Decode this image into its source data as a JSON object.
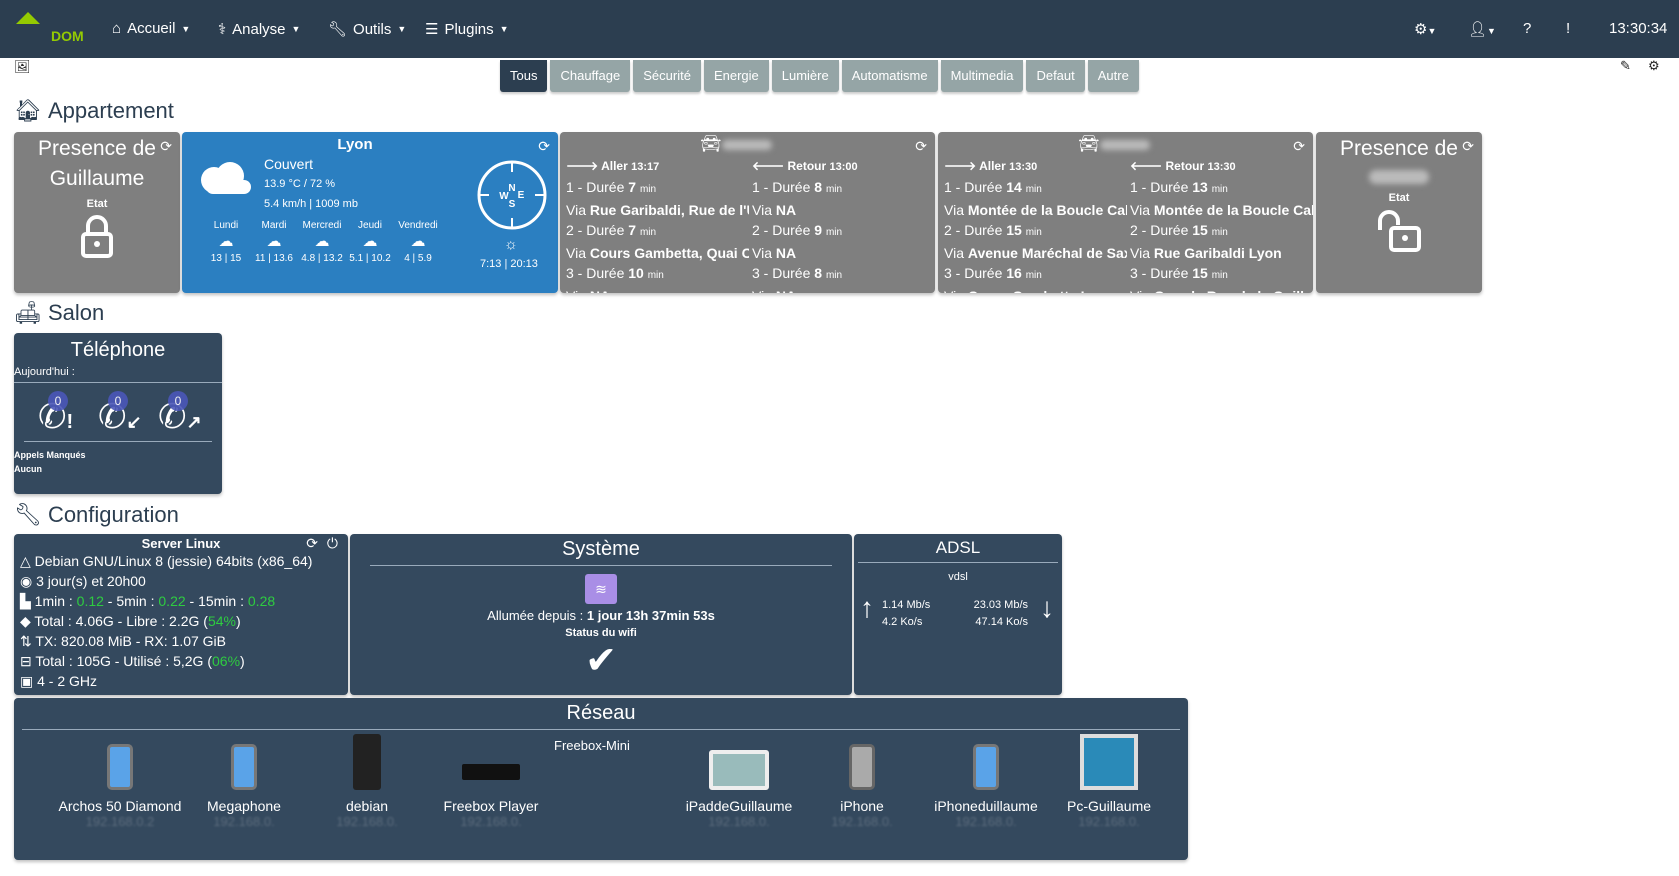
{
  "nav": {
    "logo_text": "DOM",
    "menus": [
      "Accueil",
      "Analyse",
      "Outils",
      "Plugins"
    ],
    "time": "13:30:34"
  },
  "tabs": [
    "Tous",
    "Chauffage",
    "Sécurité",
    "Energie",
    "Lumière",
    "Automatisme",
    "Multimedia",
    "Defaut",
    "Autre"
  ],
  "active_tab": "Tous",
  "sections": {
    "appartement": "Appartement",
    "salon": "Salon",
    "configuration": "Configuration"
  },
  "presence1": {
    "title": "Presence de Guillaume",
    "label": "Etat",
    "state": "locked"
  },
  "presence2": {
    "title": "Presence de",
    "label": "Etat",
    "state": "unlocked"
  },
  "weather": {
    "city": "Lyon",
    "condition": "Couvert",
    "temp_hum": "13.9 °C / 72 %",
    "wind_pressure": "5.4 km/h | 1009 mb",
    "sun": "7:13 | 20:13",
    "days": [
      {
        "name": "Lundi",
        "temps": "13 | 15"
      },
      {
        "name": "Mardi",
        "temps": "11 | 13.6"
      },
      {
        "name": "Mercredi",
        "temps": "4.8 | 13.2"
      },
      {
        "name": "Jeudi",
        "temps": "5.1 | 10.2"
      },
      {
        "name": "Vendredi",
        "temps": "4 | 5.9"
      }
    ]
  },
  "travel": [
    {
      "aller": {
        "label": "Aller",
        "time": "13:17",
        "routes": [
          {
            "n": "1 - Durée",
            "d": "7",
            "via": "Rue Garibaldi, Rue de l'U"
          },
          {
            "n": "2 - Durée",
            "d": "7",
            "via": "Cours Gambetta, Quai Cl"
          },
          {
            "n": "3 - Durée",
            "d": "10",
            "via": "NA"
          }
        ]
      },
      "retour": {
        "label": "Retour",
        "time": "13:00",
        "routes": [
          {
            "n": "1 - Durée",
            "d": "8",
            "via": "NA"
          },
          {
            "n": "2 - Durée",
            "d": "9",
            "via": "NA"
          },
          {
            "n": "3 - Durée",
            "d": "8",
            "via": "NA"
          }
        ]
      }
    },
    {
      "aller": {
        "label": "Aller",
        "time": "13:30",
        "routes": [
          {
            "n": "1 - Durée",
            "d": "14",
            "via": "Montée de la Boucle Calı"
          },
          {
            "n": "2 - Durée",
            "d": "15",
            "via": "Avenue Maréchal de Sax"
          },
          {
            "n": "3 - Durée",
            "d": "16",
            "via": "Cours Gambetta Lyon"
          }
        ]
      },
      "retour": {
        "label": "Retour",
        "time": "13:30",
        "routes": [
          {
            "n": "1 - Durée",
            "d": "13",
            "via": "Montée de la Boucle Cal"
          },
          {
            "n": "2 - Durée",
            "d": "15",
            "via": "Rue Garibaldi Lyon"
          },
          {
            "n": "3 - Durée",
            "d": "15",
            "via": "Grande Rue de la Guillot"
          }
        ]
      }
    }
  ],
  "travel_units": {
    "min": "min",
    "via": "Via"
  },
  "telephone": {
    "title": "Téléphone",
    "today": "Aujourd'hui :",
    "counts": [
      "0",
      "0",
      "0"
    ],
    "missed_label": "Appels Manqués",
    "missed_value": "Aucun"
  },
  "server": {
    "title": "Server Linux",
    "os": "Debian GNU/Linux 8 (jessie) 64bits (x86_64)",
    "uptime": "3 jour(s) et 20h00",
    "load": {
      "l1": "1min : ",
      "v1": "0.12",
      "l5": " - 5min : ",
      "v5": "0.22",
      "l15": " - 15min : ",
      "v15": "0.28"
    },
    "mem": {
      "text": "Total : 4.06G - Libre : 2.2G (",
      "pct": "54%",
      "end": ")"
    },
    "net": "TX: 820.08 MiB - RX: 1.07 GiB",
    "disk": {
      "text": "Total : 105G - Utilisé : 5,2G (",
      "pct": "06%",
      "end": ")"
    },
    "cpu": "4 - 2 GHz"
  },
  "systeme": {
    "title": "Système",
    "uptime_label": "Allumée depuis : ",
    "uptime_value": "1 jour 13h 37min 53s",
    "wifi_label": "Status du wifi"
  },
  "adsl": {
    "title": "ADSL",
    "type": "vdsl",
    "up_rate": "1.14 Mb/s",
    "up_speed": "4.2 Ko/s",
    "down_rate": "23.03 Mb/s",
    "down_speed": "47.14 Ko/s"
  },
  "reseau": {
    "title": "Réseau",
    "freebox": "Freebox-Mini",
    "devices": [
      {
        "name": "Archos 50 Diamond",
        "ip": "192.168.0.2",
        "icon": "phone"
      },
      {
        "name": "Megaphone",
        "ip": "192.168.0.",
        "icon": "phone"
      },
      {
        "name": "debian",
        "ip": "192.168.0.",
        "icon": "server"
      },
      {
        "name": "Freebox Player",
        "ip": "192.168.0.",
        "icon": "box"
      },
      {
        "name": "iPaddeGuillaume",
        "ip": "192.168.0.",
        "icon": "tablet"
      },
      {
        "name": "iPhone",
        "ip": "192.168.0.",
        "icon": "phone-gray"
      },
      {
        "name": "iPhoneduillaume",
        "ip": "192.168.0.",
        "icon": "phone"
      },
      {
        "name": "Pc-Guillaume",
        "ip": "192.168.0.",
        "icon": "pc"
      }
    ]
  },
  "colors": {
    "navbar": "#2c3e50",
    "tile_gray": "#7f7f7f",
    "tile_blue": "#2b7fc1",
    "tile_dark": "#34495e",
    "accent_green": "#94ca02",
    "ok_green": "#2ecc40"
  }
}
